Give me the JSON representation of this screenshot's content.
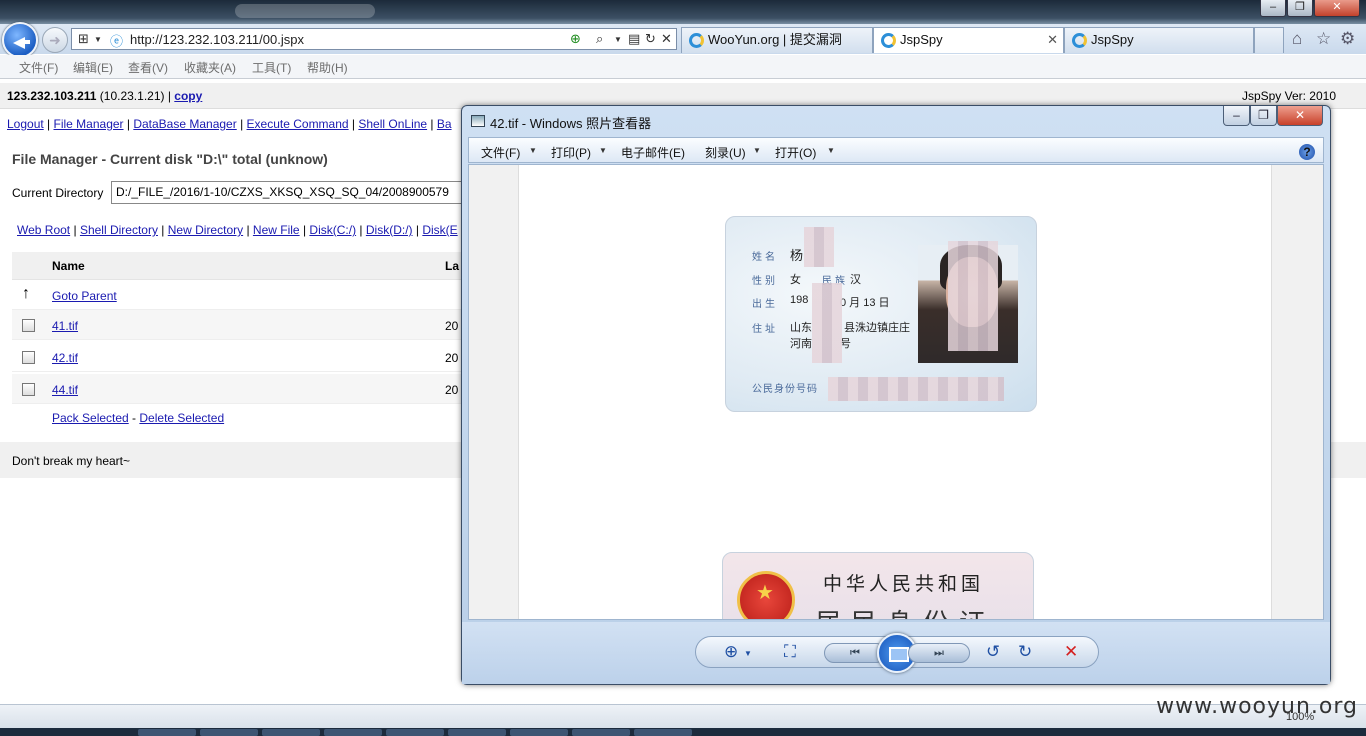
{
  "browser": {
    "url": "http://123.232.103.211/00.jspx",
    "tabs": [
      {
        "label": "WooYun.org | 提交漏洞",
        "active": false
      },
      {
        "label": "JspSpy",
        "active": true
      },
      {
        "label": "JspSpy",
        "active": false
      }
    ],
    "menu": [
      "文件(F)",
      "编辑(E)",
      "查看(V)",
      "收藏夹(A)",
      "工具(T)",
      "帮助(H)"
    ],
    "zoom": "100%"
  },
  "page": {
    "host_ip": "123.232.103.211",
    "host_internal": "(10.23.1.21)",
    "copy_label": "copy",
    "version": "JspSpy Ver: 2010",
    "nav_links": [
      "Logout",
      "File Manager",
      "DataBase Manager",
      "Execute Command",
      "Shell OnLine",
      "Ba"
    ],
    "file_manager_title": "File Manager - Current disk \"D:\\\" total (unknow)",
    "current_dir_label": "Current Directory",
    "current_dir_value": "D:/_FILE_/2016/1-10/CZXS_XKSQ_XSQ_SQ_04/2008900579",
    "quick_links": [
      "Web Root",
      "Shell Directory",
      "New Directory",
      "New File",
      "Disk(C:/)",
      "Disk(D:/)",
      "Disk(E"
    ],
    "col_name": "Name",
    "col_last": "La",
    "goto_parent": "Goto Parent",
    "files": [
      {
        "name": "41.tif",
        "date": "20"
      },
      {
        "name": "42.tif",
        "date": "20"
      },
      {
        "name": "44.tif",
        "date": "20"
      }
    ],
    "pack_selected": "Pack Selected",
    "delete_selected": "Delete Selected",
    "footer": "Don't break my heart~"
  },
  "viewer": {
    "title": "42.tif - Windows 照片查看器",
    "menu": [
      "文件(F)",
      "打印(P)",
      "电子邮件(E)",
      "刻录(U)",
      "打开(O)"
    ],
    "help": "?",
    "id_front": {
      "name_label": "姓名",
      "name_value": "杨",
      "sex_label": "性别",
      "sex_value": "女",
      "nation_label": "民族",
      "nation_value": "汉",
      "birth_label": "出生",
      "birth_value_a": "198",
      "birth_value_b": "0 月 13 日",
      "addr_label": "住址",
      "addr_line1_a": "山东",
      "addr_line1_b": "县洙边镇庄庄",
      "addr_line2_a": "河南",
      "addr_line2_b": "号",
      "id_label": "公民身份号码"
    },
    "id_back": {
      "line1": "中华人民共和国",
      "line2": "居民身份证"
    }
  },
  "watermark": "www.wooyun.org"
}
